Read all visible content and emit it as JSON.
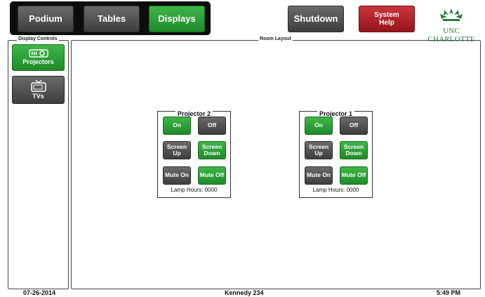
{
  "nav": {
    "podium": "Podium",
    "tables": "Tables",
    "displays": "Displays"
  },
  "actions": {
    "shutdown": "Shutdown",
    "system_help": "System Help"
  },
  "logo": {
    "text": "UNC CHARLOTTE"
  },
  "display_controls": {
    "legend": "Display Controls",
    "items": [
      {
        "label": "Projectors",
        "icon": "projector-icon",
        "active": true
      },
      {
        "label": "TVs",
        "icon": "tv-icon",
        "active": false
      }
    ]
  },
  "room_layout": {
    "legend": "Room Layout",
    "projectors": [
      {
        "title": "Projector 2",
        "on": "On",
        "off": "Off",
        "screen_up": "Screen Up",
        "screen_down": "Screen Down",
        "mute_on": "Mute On",
        "mute_off": "Mute Off",
        "lamp_hours": "Lamp Hours: 0000"
      },
      {
        "title": "Projector 1",
        "on": "On",
        "off": "Off",
        "screen_up": "Screen Up",
        "screen_down": "Screen Down",
        "mute_on": "Mute On",
        "mute_off": "Mute Off",
        "lamp_hours": "Lamp Hours: 0000"
      }
    ]
  },
  "footer": {
    "date": "07-26-2014",
    "room": "Kennedy 234",
    "time": "5:49 PM"
  },
  "colors": {
    "active_green": "#2ca03a",
    "inactive_gray": "#555555",
    "help_red": "#b0232a",
    "brand_green": "#2b7d3a"
  }
}
